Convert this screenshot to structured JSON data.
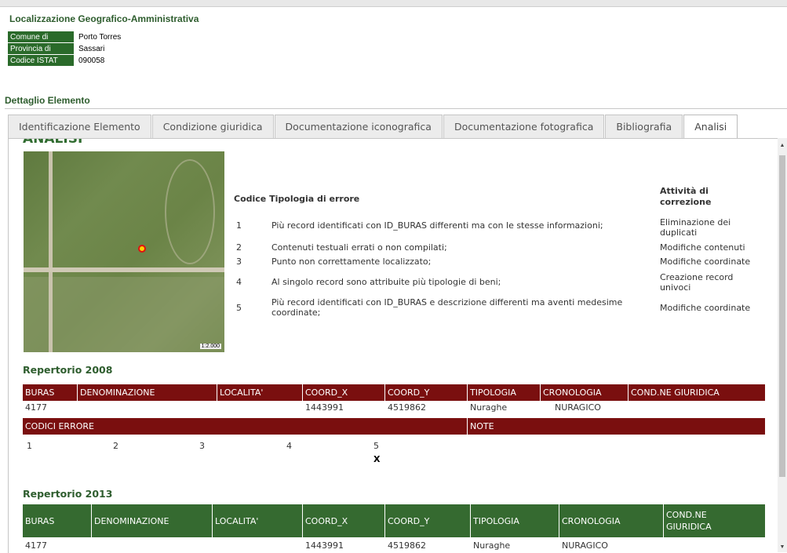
{
  "location": {
    "title": "Localizzazione Geografico-Amministrativa",
    "rows": [
      {
        "label": "Comune di",
        "value": "Porto Torres"
      },
      {
        "label": "Provincia di",
        "value": "Sassari"
      },
      {
        "label": "Codice ISTAT",
        "value": "090058"
      }
    ]
  },
  "detail_title": "Dettaglio Elemento",
  "tabs": [
    {
      "label": "Identificazione Elemento",
      "active": false
    },
    {
      "label": "Condizione giuridica",
      "active": false
    },
    {
      "label": "Documentazione iconografica",
      "active": false
    },
    {
      "label": "Documentazione fotografica",
      "active": false
    },
    {
      "label": "Bibliografia",
      "active": false
    },
    {
      "label": "Analisi",
      "active": true
    }
  ],
  "analisi": {
    "heading": "ANALISI",
    "map_scale": "1:2.000",
    "errors_header": {
      "code": "Codice",
      "type": "Tipologia di errore",
      "correction": "Attività di correzione"
    },
    "errors": [
      {
        "code": "1",
        "desc": "Più record identificati con ID_BURAS differenti ma con le stesse informazioni;",
        "fix": "Eliminazione dei duplicati"
      },
      {
        "code": "2",
        "desc": "Contenuti testuali errati o non compilati;",
        "fix": "Modifiche contenuti"
      },
      {
        "code": "3",
        "desc": "Punto non correttamente localizzato;",
        "fix": "Modifiche coordinate"
      },
      {
        "code": "4",
        "desc": "Al singolo record sono attribuite più tipologie di beni;",
        "fix": "Creazione record univoci"
      },
      {
        "code": "5",
        "desc": "Più record identificati con ID_BURAS e descrizione differenti ma aventi medesime coordinate;",
        "fix": "Modifiche coordinate"
      }
    ]
  },
  "rep2008": {
    "title": "Repertorio 2008",
    "headers": [
      "BURAS",
      "DENOMINAZIONE",
      "LOCALITA'",
      "COORD_X",
      "COORD_Y",
      "TIPOLOGIA",
      "CRONOLOGIA",
      "COND.NE GIURIDICA"
    ],
    "row": [
      "4177",
      "",
      "",
      "1443991",
      "4519862",
      "Nuraghe",
      "NURAGICO",
      ""
    ],
    "codes_header": "CODICI ERRORE",
    "note_header": "NOTE",
    "codes": [
      "1",
      "2",
      "3",
      "4",
      "5"
    ],
    "marks": [
      "",
      "",
      "",
      "",
      "X"
    ]
  },
  "rep2013": {
    "title": "Repertorio 2013",
    "headers": [
      "BURAS",
      "DENOMINAZIONE",
      "LOCALITA'",
      "COORD_X",
      "COORD_Y",
      "TIPOLOGIA",
      "CRONOLOGIA",
      "COND.NE GIURIDICA"
    ],
    "row": [
      "4177",
      "",
      "",
      "1443991",
      "4519862",
      "Nuraghe",
      "NURAGICO",
      ""
    ]
  }
}
